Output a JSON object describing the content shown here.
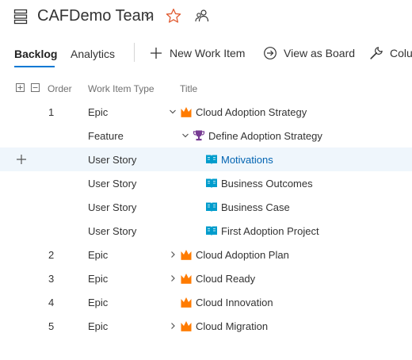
{
  "header": {
    "team_name": "CAFDemo Team",
    "icons": {
      "backlogs": "backlogs-icon",
      "dropdown": "chevron-down-icon",
      "favorite": "star-outline-icon",
      "members": "people-icon"
    },
    "star_color": "#e05a30"
  },
  "toolbar": {
    "tabs": [
      {
        "label": "Backlog",
        "active": true
      },
      {
        "label": "Analytics",
        "active": false
      }
    ],
    "new_item_label": "New Work Item",
    "board_label": "View as Board",
    "columns_label": "Colu",
    "accent": "#0078d4"
  },
  "grid": {
    "columns": {
      "order": "Order",
      "type": "Work Item Type",
      "title": "Title"
    },
    "rows": [
      {
        "order": "1",
        "type": "Epic",
        "title": "Cloud Adoption Strategy",
        "level": 0,
        "expander": "expanded",
        "icon": "crown-icon"
      },
      {
        "order": "",
        "type": "Feature",
        "title": "Define Adoption Strategy",
        "level": 1,
        "expander": "expanded",
        "icon": "trophy-icon"
      },
      {
        "order": "",
        "type": "User Story",
        "title": "Motivations",
        "level": 2,
        "expander": "none",
        "icon": "book-icon",
        "selected": true
      },
      {
        "order": "",
        "type": "User Story",
        "title": "Business Outcomes",
        "level": 2,
        "expander": "none",
        "icon": "book-icon"
      },
      {
        "order": "",
        "type": "User Story",
        "title": "Business Case",
        "level": 2,
        "expander": "none",
        "icon": "book-icon"
      },
      {
        "order": "",
        "type": "User Story",
        "title": "First Adoption Project",
        "level": 2,
        "expander": "none",
        "icon": "book-icon"
      },
      {
        "order": "2",
        "type": "Epic",
        "title": "Cloud Adoption Plan",
        "level": 0,
        "expander": "collapsed",
        "icon": "crown-icon"
      },
      {
        "order": "3",
        "type": "Epic",
        "title": "Cloud Ready",
        "level": 0,
        "expander": "collapsed",
        "icon": "crown-icon"
      },
      {
        "order": "4",
        "type": "Epic",
        "title": "Cloud Innovation",
        "level": 0,
        "expander": "none",
        "icon": "crown-icon"
      },
      {
        "order": "5",
        "type": "Epic",
        "title": "Cloud Migration",
        "level": 0,
        "expander": "collapsed",
        "icon": "crown-icon"
      }
    ]
  },
  "colors": {
    "epic": "#ff7b00",
    "feature": "#773b93",
    "user_story": "#009ccc",
    "link": "#0063b1",
    "selected_row": "#eff6fc"
  }
}
